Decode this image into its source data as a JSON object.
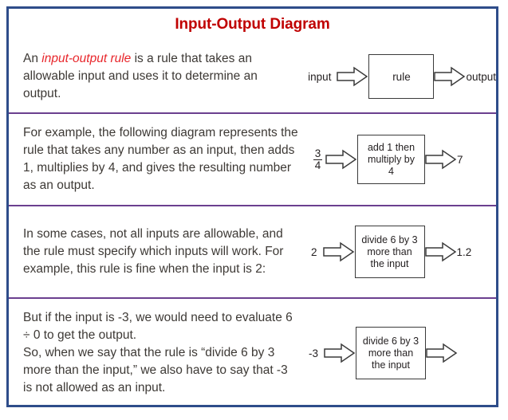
{
  "header": {
    "title": "Input-Output Diagram",
    "title_color": "#c00000"
  },
  "theme": {
    "frame_border_color": "#2e4d8a",
    "separator_color": "#6b3f8f",
    "body_text_color": "#3d3935",
    "accent_red": "#e8262b",
    "diagram_stroke": "#3a3a3a",
    "background": "#ffffff"
  },
  "sections": [
    {
      "paragraph_prefix": "An ",
      "paragraph_emphasis": "input-output rule",
      "paragraph_suffix": " is a rule that takes an allowable input and uses it to determine an output.",
      "diagram": {
        "input_label": "input",
        "box_lines": [
          "rule"
        ],
        "output_label": "output"
      }
    },
    {
      "paragraph": "For example, the following diagram represents the rule that takes any number as an input, then adds 1, multiplies by 4, and gives the resulting number as an output.",
      "diagram": {
        "input_fraction_numerator": "3",
        "input_fraction_denominator": "4",
        "box_lines": [
          "add 1 then",
          "multiply by",
          "4"
        ],
        "output_label": "7"
      }
    },
    {
      "paragraph": "In some cases, not all inputs are allowable, and the rule must specify which inputs will work. For example, this rule is fine when the input is 2:",
      "diagram": {
        "input_label": "2",
        "box_lines": [
          "divide 6 by 3",
          "more than",
          "the input"
        ],
        "output_label": "1.2"
      }
    },
    {
      "paragraph": "But if the input is -3, we would need to evaluate 6 ÷ 0 to get the output.\nSo, when we say that the rule is “divide 6 by 3 more than the input,” we also have to say that -3 is not allowed as an input.",
      "diagram": {
        "input_label": "-3",
        "box_lines": [
          "divide 6 by 3",
          "more than",
          "the input"
        ],
        "output_label": ""
      }
    }
  ]
}
